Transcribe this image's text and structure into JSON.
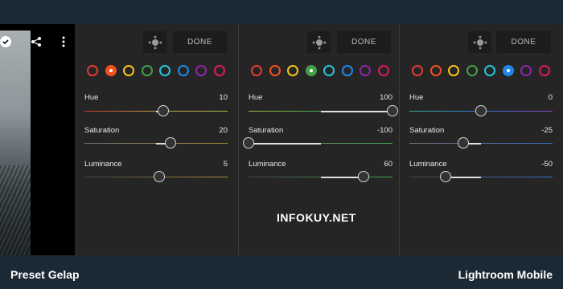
{
  "toolbar": {
    "icons": [
      "checkmark-icon",
      "share-icon",
      "more-vert-icon"
    ]
  },
  "panels": [
    {
      "done_label": "DONE",
      "selected_color": "orange",
      "sliders": [
        {
          "label": "Hue",
          "value": "10",
          "fraction": 0.55
        },
        {
          "label": "Saturation",
          "value": "20",
          "fraction": 0.6
        },
        {
          "label": "Luminance",
          "value": "5",
          "fraction": 0.52
        }
      ]
    },
    {
      "done_label": "DONE",
      "selected_color": "green",
      "sliders": [
        {
          "label": "Hue",
          "value": "100",
          "fraction": 1.0
        },
        {
          "label": "Saturation",
          "value": "-100",
          "fraction": 0.0
        },
        {
          "label": "Luminance",
          "value": "60",
          "fraction": 0.8
        }
      ]
    },
    {
      "done_label": "DONE",
      "selected_color": "blue",
      "sliders": [
        {
          "label": "Hue",
          "value": "0",
          "fraction": 0.5
        },
        {
          "label": "Saturation",
          "value": "-25",
          "fraction": 0.375
        },
        {
          "label": "Luminance",
          "value": "-50",
          "fraction": 0.25
        }
      ]
    }
  ],
  "color_dots": [
    {
      "name": "red",
      "color": "#e53935"
    },
    {
      "name": "orange",
      "color": "#f4511e"
    },
    {
      "name": "yellow",
      "color": "#f9c21b"
    },
    {
      "name": "green",
      "color": "#43a047"
    },
    {
      "name": "aqua",
      "color": "#26c6da"
    },
    {
      "name": "blue",
      "color": "#1e88e5"
    },
    {
      "name": "purple",
      "color": "#8e24aa"
    },
    {
      "name": "magenta",
      "color": "#d81b60"
    }
  ],
  "watermark": "INFOKUY.NET",
  "footer": {
    "left": "Preset Gelap",
    "right": "Lightroom Mobile"
  }
}
